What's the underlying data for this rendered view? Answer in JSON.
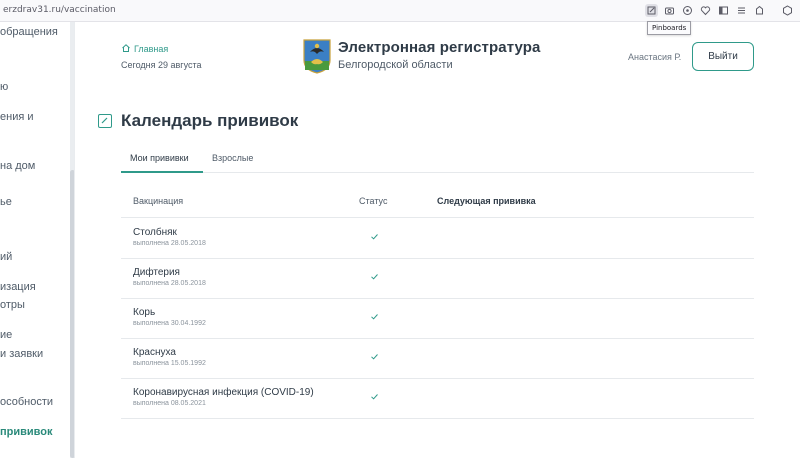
{
  "browser": {
    "url": "erzdrav31.ru/vaccination",
    "tooltip": "Pinboards",
    "toolbar_icons": [
      "pinboard-icon",
      "screenshot-icon",
      "extension-icon",
      "heart-icon",
      "reader-icon",
      "list-icon",
      "lock-icon",
      "pocket-icon"
    ]
  },
  "sidebar": {
    "items": [
      {
        "label": "обращения",
        "active": false
      },
      {
        "label": "ю",
        "active": false
      },
      {
        "label": "ения и",
        "active": false
      },
      {
        "label": "на дом",
        "active": false
      },
      {
        "label": "ье",
        "active": false
      },
      {
        "label": "ий",
        "active": false
      },
      {
        "label": "изация",
        "active": false
      },
      {
        "label": "отры",
        "active": false
      },
      {
        "label": "ие",
        "active": false
      },
      {
        "label": "и заявки",
        "active": false
      },
      {
        "label": "особности",
        "active": false
      },
      {
        "label": "прививок",
        "active": true
      }
    ]
  },
  "header": {
    "home_label": "Главная",
    "date_text": "Сегодня 29 августа",
    "brand_title": "Электронная регистратура",
    "brand_subtitle": "Белгородской области",
    "user_name": "Анастасия Р.",
    "logout_label": "Выйти"
  },
  "page": {
    "title": "Календарь прививок",
    "tabs": [
      {
        "label": "Мои прививки",
        "active": true
      },
      {
        "label": "Взрослые",
        "active": false
      }
    ]
  },
  "table": {
    "columns": [
      "Вакцинация",
      "Статус",
      "Следующая прививка"
    ],
    "rows": [
      {
        "name": "Столбняк",
        "date": "выполнена 28.05.2018",
        "status": "done"
      },
      {
        "name": "Дифтерия",
        "date": "выполнена 28.05.2018",
        "status": "done"
      },
      {
        "name": "Корь",
        "date": "выполнена 30.04.1992",
        "status": "done"
      },
      {
        "name": "Краснуха",
        "date": "выполнена 15.05.1992",
        "status": "done"
      },
      {
        "name": "Коронавирусная инфекция (COVID-19)",
        "date": "выполнена 08.05.2021",
        "status": "done"
      }
    ]
  },
  "colors": {
    "accent": "#2f9a8a",
    "text": "#2f3b47",
    "muted": "#8a939c",
    "divider": "#e6e9ec"
  }
}
